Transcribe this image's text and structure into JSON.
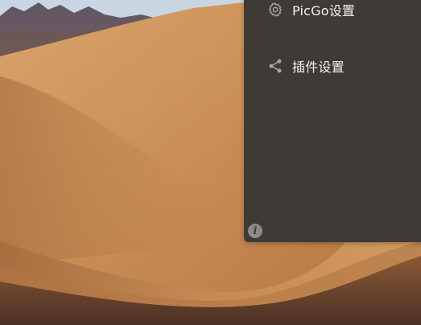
{
  "menu": {
    "items": [
      {
        "label": "PicGo设置",
        "icon": "gear-icon"
      },
      {
        "label": "插件设置",
        "icon": "share-icon"
      }
    ]
  },
  "info_button": {
    "glyph": "i",
    "icon": "info-icon"
  },
  "colors": {
    "panel": "#3e3b37",
    "text": "#f1f1f1",
    "icon": "#a9a8a6",
    "sand": "#c8925a",
    "sky": "#cfd9e3"
  }
}
